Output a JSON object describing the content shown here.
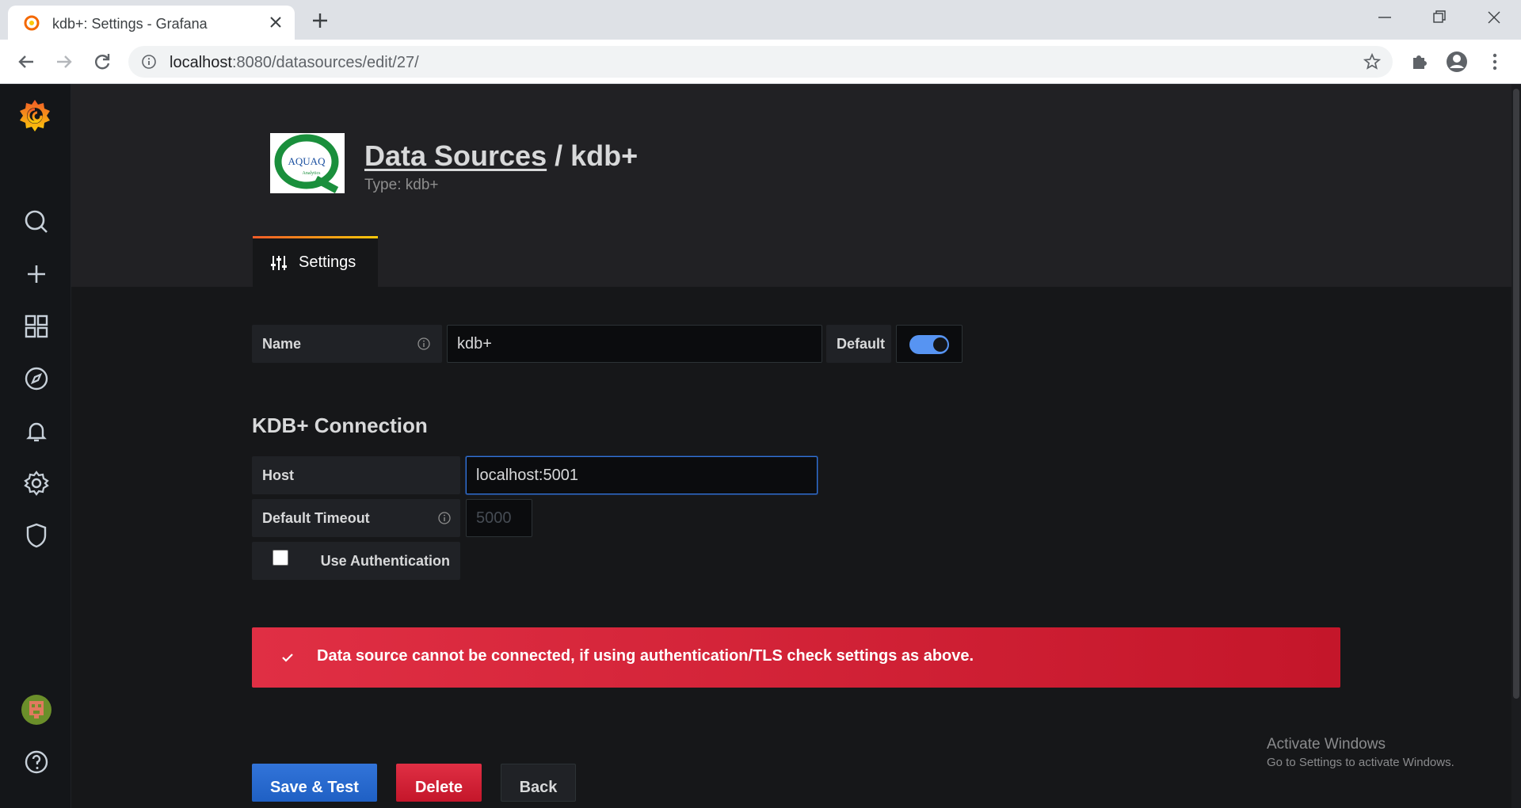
{
  "browser": {
    "tab_title": "kdb+: Settings - Grafana",
    "url_host": "localhost",
    "url_path": ":8080/datasources/edit/27/"
  },
  "header": {
    "breadcrumb_link": "Data Sources",
    "separator": " / ",
    "title": "kdb+",
    "subtitle": "Type: kdb+",
    "logo_text": "AQUAQ",
    "logo_subtext": "Analytics",
    "tabs": [
      {
        "label": "Settings",
        "active": true
      }
    ]
  },
  "form": {
    "name_label": "Name",
    "name_value": "kdb+",
    "default_label": "Default",
    "default_enabled": true,
    "section_title": "KDB+ Connection",
    "host_label": "Host",
    "host_value": "localhost:5001",
    "timeout_label": "Default Timeout",
    "timeout_placeholder": "5000",
    "auth_label": "Use Authentication",
    "auth_checked": false
  },
  "alert": {
    "text": "Data source cannot be connected, if using authentication/TLS check settings as above.",
    "color": "#e02f44"
  },
  "buttons": {
    "save": "Save & Test",
    "delete": "Delete",
    "back": "Back"
  },
  "watermark": {
    "title": "Activate Windows",
    "subtitle": "Go to Settings to activate Windows."
  },
  "sidemenu": {
    "icons": [
      "grafana-logo-icon",
      "search-icon",
      "plus-icon",
      "dashboards-icon",
      "explore-icon",
      "alerting-icon",
      "gear-icon",
      "shield-icon",
      "avatar",
      "help-icon"
    ]
  },
  "colors": {
    "primary": "#3274d9",
    "danger": "#e02f44",
    "toggle": "#5794f2",
    "background": "#161719"
  }
}
